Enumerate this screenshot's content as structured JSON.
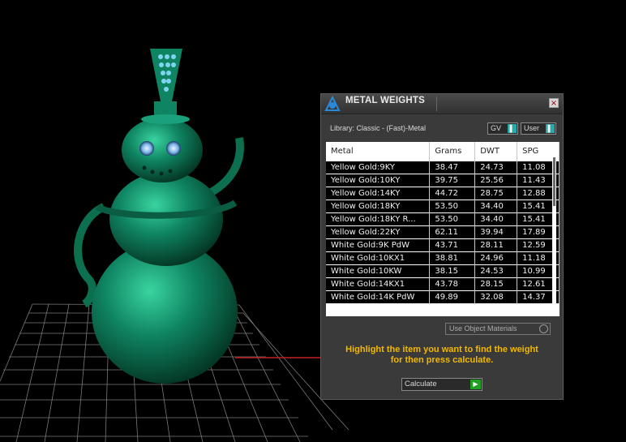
{
  "panel": {
    "title": "METAL WEIGHTS",
    "close_label": "×",
    "library_label": "Library: Classic - (Fast)-Metal",
    "unit_dropdown": "GV",
    "user_dropdown": "User",
    "columns": [
      "Metal",
      "Grams",
      "DWT",
      "SPG"
    ],
    "rows": [
      [
        "Yellow Gold:9KY",
        "38.47",
        "24.73",
        "11.08"
      ],
      [
        "Yellow Gold:10KY",
        "39.75",
        "25.56",
        "11.43"
      ],
      [
        "Yellow Gold:14KY",
        "44.72",
        "28.75",
        "12.88"
      ],
      [
        "Yellow Gold:18KY",
        "53.50",
        "34.40",
        "15.41"
      ],
      [
        "Yellow Gold:18KY R...",
        "53.50",
        "34.40",
        "15.41"
      ],
      [
        "Yellow Gold:22KY",
        "62.11",
        "39.94",
        "17.89"
      ],
      [
        "White Gold:9K PdW",
        "43.71",
        "28.11",
        "12.59"
      ],
      [
        "White Gold:10KX1",
        "38.81",
        "24.96",
        "11.18"
      ],
      [
        "White Gold:10KW",
        "38.15",
        "24.53",
        "10.99"
      ],
      [
        "White Gold:14KX1",
        "43.78",
        "28.15",
        "12.61"
      ],
      [
        "White Gold:14K PdW",
        "49.89",
        "32.08",
        "14.37"
      ]
    ],
    "use_object_materials": "Use Object Materials",
    "hint_line1": "Highlight the item you want to find the weight",
    "hint_line2": "for then press calculate.",
    "calculate_label": "Calculate"
  },
  "colors": {
    "model": "#0e7a5a",
    "model_highlight": "#2fc896",
    "hint_text": "#f0b800",
    "accent": "#28a8a8"
  }
}
